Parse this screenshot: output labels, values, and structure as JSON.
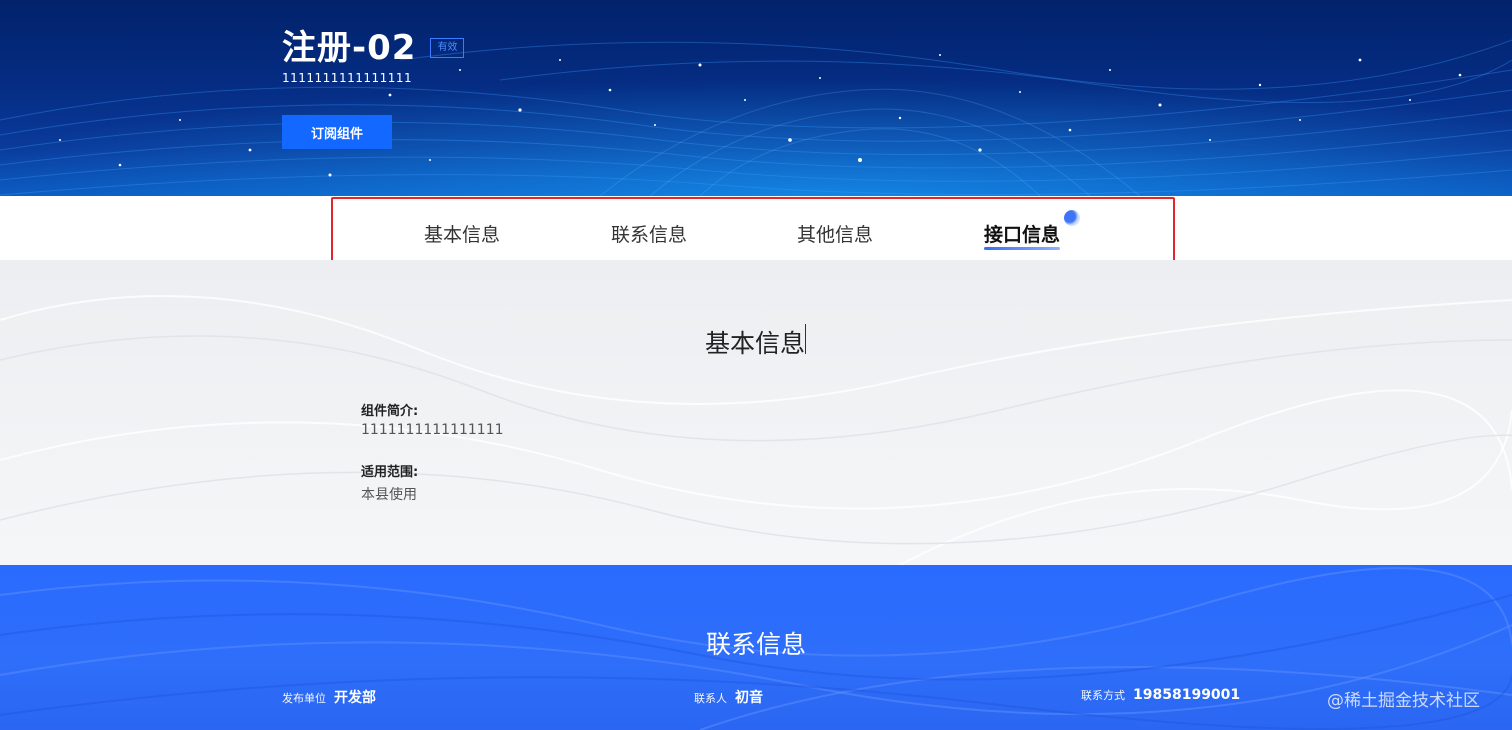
{
  "hero": {
    "title": "注册-02",
    "status_badge": "有效",
    "subtitle": "1111111111111111",
    "subscribe_label": "订阅组件"
  },
  "tabs": [
    {
      "label": "基本信息",
      "active": false
    },
    {
      "label": "联系信息",
      "active": false
    },
    {
      "label": "其他信息",
      "active": false
    },
    {
      "label": "接口信息",
      "active": true
    }
  ],
  "basic_info": {
    "title": "基本信息",
    "fields": [
      {
        "label": "组件简介:",
        "value": "1111111111111111"
      },
      {
        "label": "适用范围:",
        "value": "本县使用"
      }
    ]
  },
  "contact_info": {
    "title": "联系信息",
    "items": [
      {
        "label": "发布单位",
        "value": "开发部"
      },
      {
        "label": "联系人",
        "value": "初音"
      },
      {
        "label": "联系方式",
        "value": "19858199001"
      }
    ]
  },
  "watermark": "@稀土掘金技术社区",
  "colors": {
    "hero_bg": "#052d84",
    "accent": "#1368ff",
    "highlight_border": "#e3262a",
    "contact_bg": "#2a6bff"
  }
}
